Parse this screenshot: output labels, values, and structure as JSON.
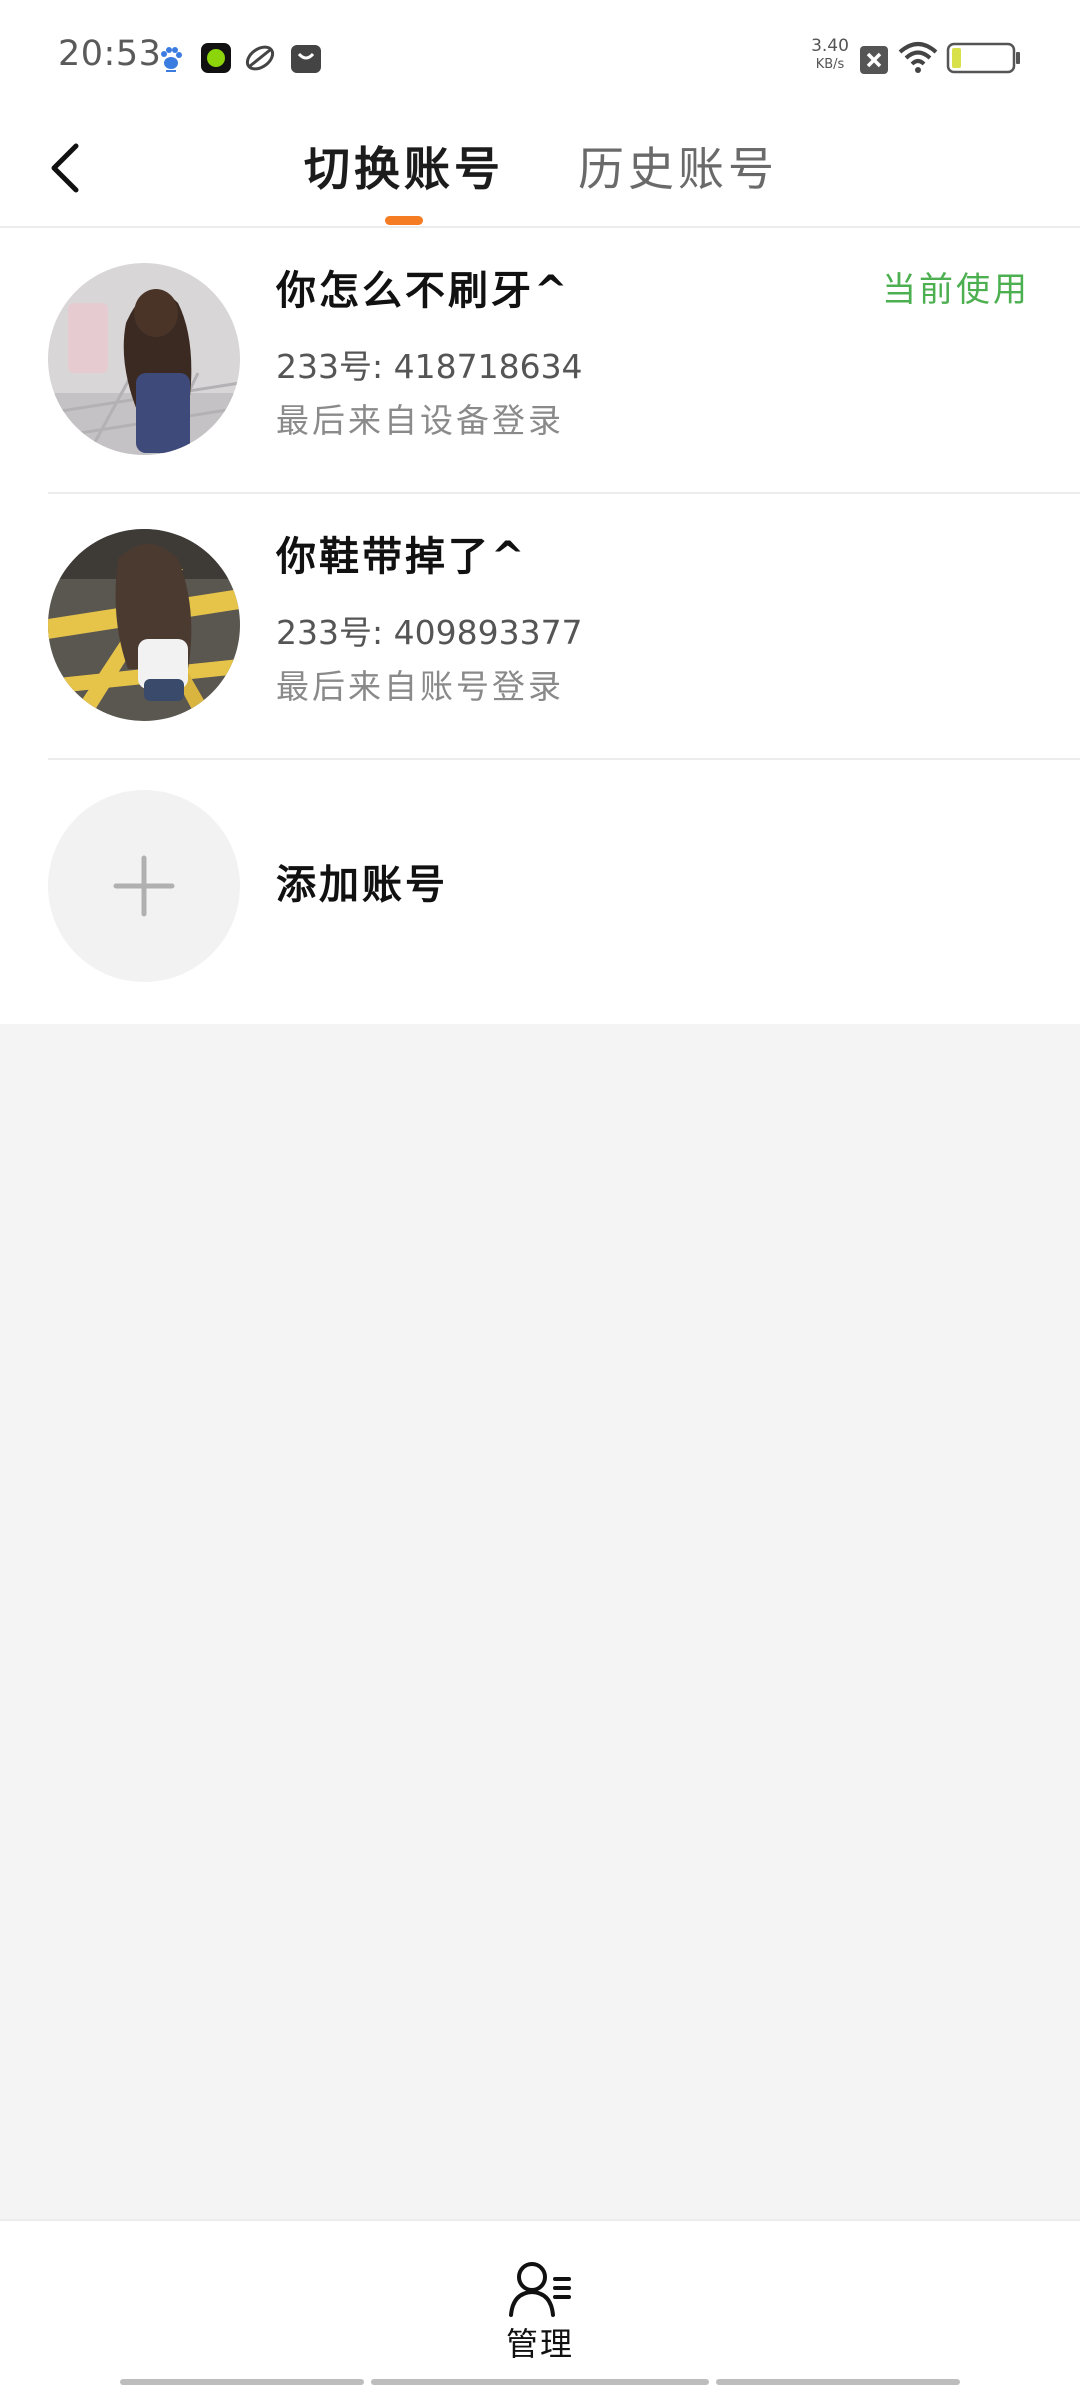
{
  "status_bar": {
    "time": "20:53",
    "net_speed_value": "3.40",
    "net_speed_unit": "KB/s",
    "icons": [
      "baidu-paw-icon",
      "green-app-icon",
      "leaf-app-icon",
      "shopping-bag-icon",
      "close-box-icon",
      "wifi-icon",
      "battery-icon"
    ]
  },
  "header": {
    "back_icon": "chevron-left-icon",
    "tabs": [
      {
        "label": "切换账号",
        "active": true
      },
      {
        "label": "历史账号",
        "active": false
      }
    ],
    "accent_color": "#f57c22"
  },
  "accounts": [
    {
      "name": "你怎么不刷牙^",
      "id_text": "233号: 418718634",
      "login_text": "最后来自设备登录",
      "badge": "当前使用"
    },
    {
      "name": "你鞋带掉了^",
      "id_text": "233号: 409893377",
      "login_text": "最后来自账号登录"
    }
  ],
  "add_account": {
    "label": "添加账号",
    "icon": "plus-icon"
  },
  "bottom_bar": {
    "manage_label": "管理",
    "manage_icon": "user-list-icon"
  },
  "colors": {
    "badge": "#4caf50",
    "background": "#f4f4f4"
  }
}
